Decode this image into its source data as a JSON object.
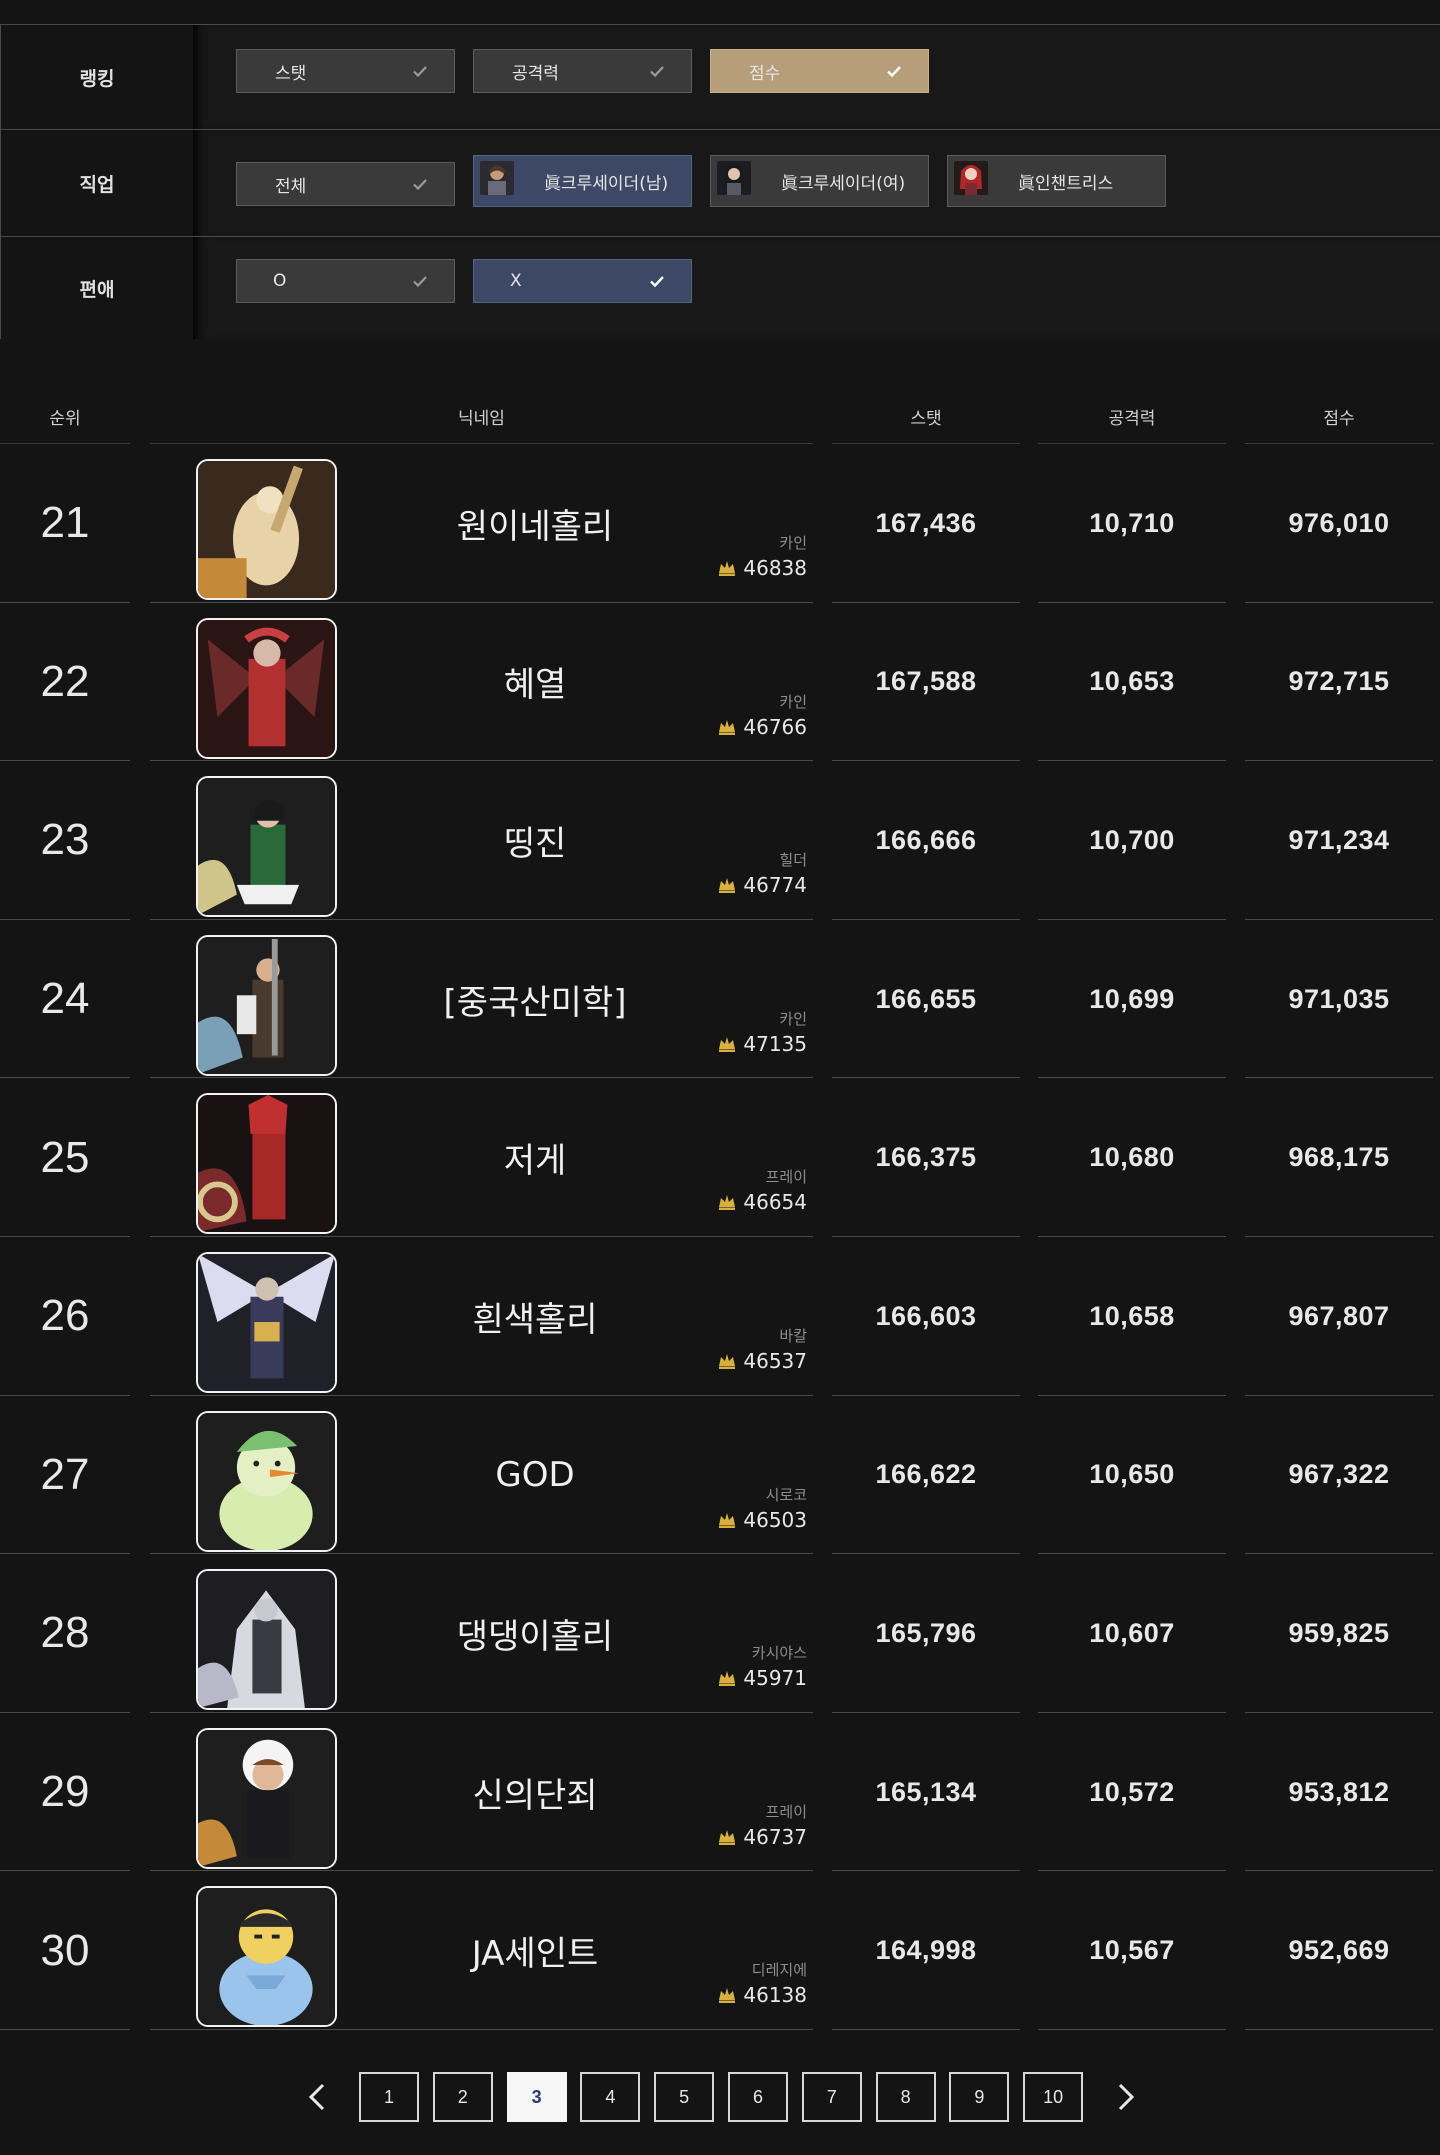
{
  "filters": {
    "ranking": {
      "label": "랭킹",
      "options": [
        {
          "label": "스탯",
          "style": "default"
        },
        {
          "label": "공격력",
          "style": "default"
        },
        {
          "label": "점수",
          "style": "gold"
        }
      ]
    },
    "job": {
      "label": "직업",
      "options": [
        {
          "label": "전체",
          "style": "default"
        },
        {
          "label": "眞크루세이더(남)",
          "style": "navy",
          "portrait": "crusader-male"
        },
        {
          "label": "眞크루세이더(여)",
          "style": "default",
          "portrait": "crusader-female"
        },
        {
          "label": "眞인챈트리스",
          "style": "default",
          "portrait": "enchantress"
        }
      ]
    },
    "favorite": {
      "label": "편애",
      "options": [
        {
          "label": "O",
          "style": "default"
        },
        {
          "label": "X",
          "style": "navy"
        }
      ]
    }
  },
  "table": {
    "headers": {
      "rank": "순위",
      "nickname": "닉네임",
      "stat": "스탯",
      "attack": "공격력",
      "score": "점수"
    },
    "rows": [
      {
        "rank": "21",
        "nickname": "원이네홀리",
        "server": "카인",
        "level": "46838",
        "stat": "167,436",
        "attack": "10,710",
        "score": "976,010"
      },
      {
        "rank": "22",
        "nickname": "혜열",
        "server": "카인",
        "level": "46766",
        "stat": "167,588",
        "attack": "10,653",
        "score": "972,715"
      },
      {
        "rank": "23",
        "nickname": "띵진",
        "server": "힐더",
        "level": "46774",
        "stat": "166,666",
        "attack": "10,700",
        "score": "971,234"
      },
      {
        "rank": "24",
        "nickname": "[중국산미학]",
        "server": "카인",
        "level": "47135",
        "stat": "166,655",
        "attack": "10,699",
        "score": "971,035"
      },
      {
        "rank": "25",
        "nickname": "저게",
        "server": "프레이",
        "level": "46654",
        "stat": "166,375",
        "attack": "10,680",
        "score": "968,175"
      },
      {
        "rank": "26",
        "nickname": "흰색홀리",
        "server": "바칼",
        "level": "46537",
        "stat": "166,603",
        "attack": "10,658",
        "score": "967,807"
      },
      {
        "rank": "27",
        "nickname": "GOD",
        "server": "시로코",
        "level": "46503",
        "stat": "166,622",
        "attack": "10,650",
        "score": "967,322"
      },
      {
        "rank": "28",
        "nickname": "댕댕이홀리",
        "server": "카시야스",
        "level": "45971",
        "stat": "165,796",
        "attack": "10,607",
        "score": "959,825"
      },
      {
        "rank": "29",
        "nickname": "신의단죄",
        "server": "프레이",
        "level": "46737",
        "stat": "165,134",
        "attack": "10,572",
        "score": "953,812"
      },
      {
        "rank": "30",
        "nickname": "JA세인트",
        "server": "디레지에",
        "level": "46138",
        "stat": "164,998",
        "attack": "10,567",
        "score": "952,669"
      }
    ]
  },
  "pagination": {
    "pages": [
      "1",
      "2",
      "3",
      "4",
      "5",
      "6",
      "7",
      "8",
      "9",
      "10"
    ],
    "current": "3"
  },
  "colors": {
    "gold": "#b79e7b",
    "navy": "#3c4866",
    "chip": "#3a3a3a",
    "background": "#141414"
  }
}
